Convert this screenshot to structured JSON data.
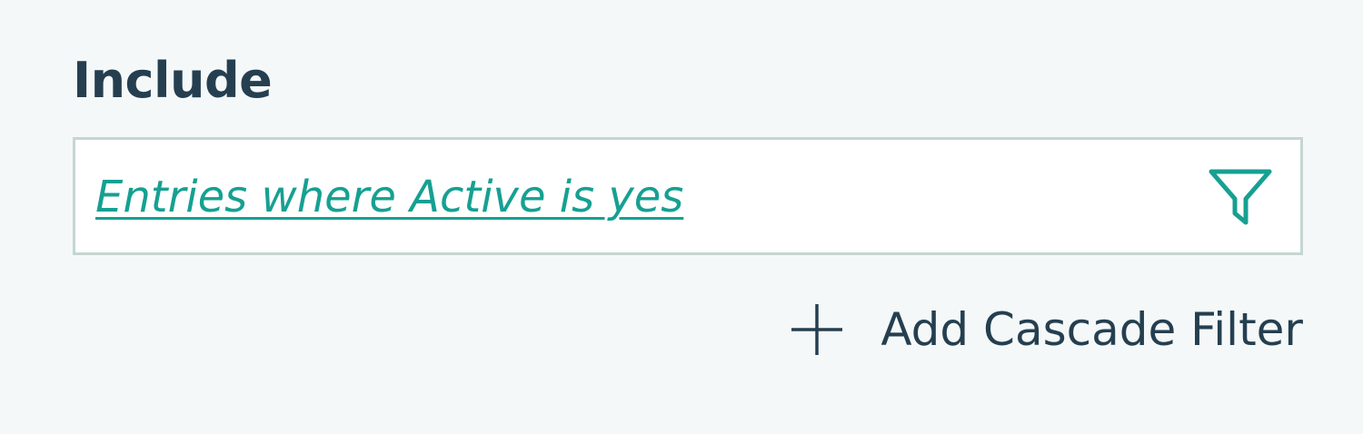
{
  "section": {
    "title": "Include"
  },
  "filter": {
    "link_text": "Entries where Active is yes",
    "icon": "filter-funnel-icon"
  },
  "actions": {
    "add_cascade_label": "Add Cascade Filter",
    "add_icon": "plus-icon"
  },
  "colors": {
    "background": "#f5f8f9",
    "heading": "#253f50",
    "accent": "#16a092",
    "border": "#c6d6d2"
  }
}
